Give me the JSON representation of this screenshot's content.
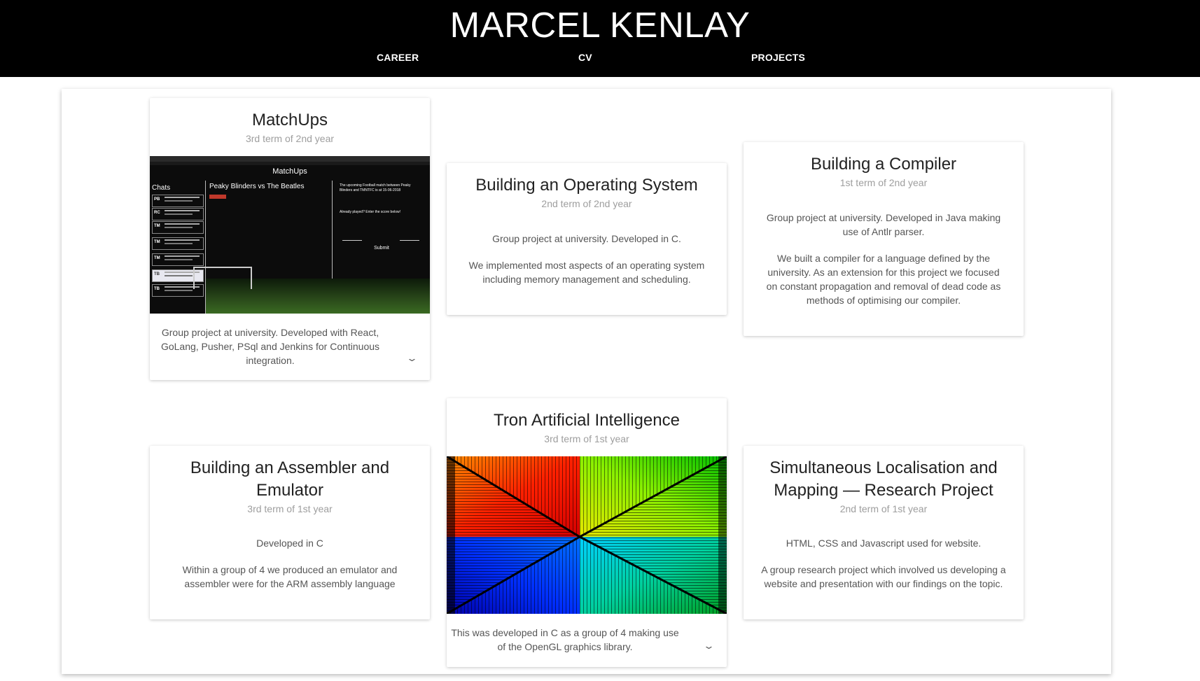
{
  "header": {
    "title": "MARCEL KENLAY",
    "nav": [
      "CAREER",
      "CV",
      "PROJECTS"
    ]
  },
  "colors": {
    "header_bg": "#000000",
    "header_text": "#ffffff",
    "subtitle": "#9e9e9e"
  },
  "projects": [
    {
      "title": "MatchUps",
      "term": "3rd term of 2nd year",
      "body": [
        "Group project at university. Developed with React, GoLang, Pusher, PSql and Jenkins for Continuous integration."
      ],
      "has_image": true,
      "expand_icon": "chevron-down-icon",
      "screenshot": {
        "app_title": "MatchUps",
        "chats_label": "Chats",
        "match_title": "Peaky Blinders vs The Beatles",
        "chat_badges": [
          "PB",
          "RC",
          "TM",
          "TM",
          "TM",
          "TB",
          "TB"
        ],
        "right_text": "The upcoming Football match between Peaky Blinders and TMNTFC is at 15-06-2018",
        "prompt": "Already played? Enter the score below!",
        "submit": "Submit"
      }
    },
    {
      "title": "Building an Operating System",
      "term": "2nd term of 2nd year",
      "body": [
        "Group project at university. Developed in C.",
        "We implemented most aspects of an operating system including memory management and scheduling."
      ]
    },
    {
      "title": "Building a Compiler",
      "term": "1st term of 2nd year",
      "body": [
        "Group project at university. Developed in Java making use of Antlr parser.",
        "We built a compiler for a language defined by the university. As an extension for this project we focused on constant propagation and removal of dead code as methods of optimising our compiler."
      ]
    },
    {
      "title": "Building an Assembler and Emulator",
      "term": "3rd term of 1st year",
      "body": [
        "Developed in C",
        "Within a group of 4 we produced an emulator and assembler were for the ARM assembly language"
      ]
    },
    {
      "title": "Tron Artificial Intelligence",
      "term": "3rd term of 1st year",
      "body": [
        "This was developed in C as a group of 4 making use of the OpenGL graphics library."
      ],
      "has_image": true,
      "expand_icon": "chevron-down-icon"
    },
    {
      "title": "Simultaneous Localisation and Mapping — Research Project",
      "term": "2nd term of 1st year",
      "body": [
        "HTML, CSS and Javascript used for website.",
        "A group research project which involved us developing a website and presentation with our findings on the topic."
      ]
    }
  ]
}
